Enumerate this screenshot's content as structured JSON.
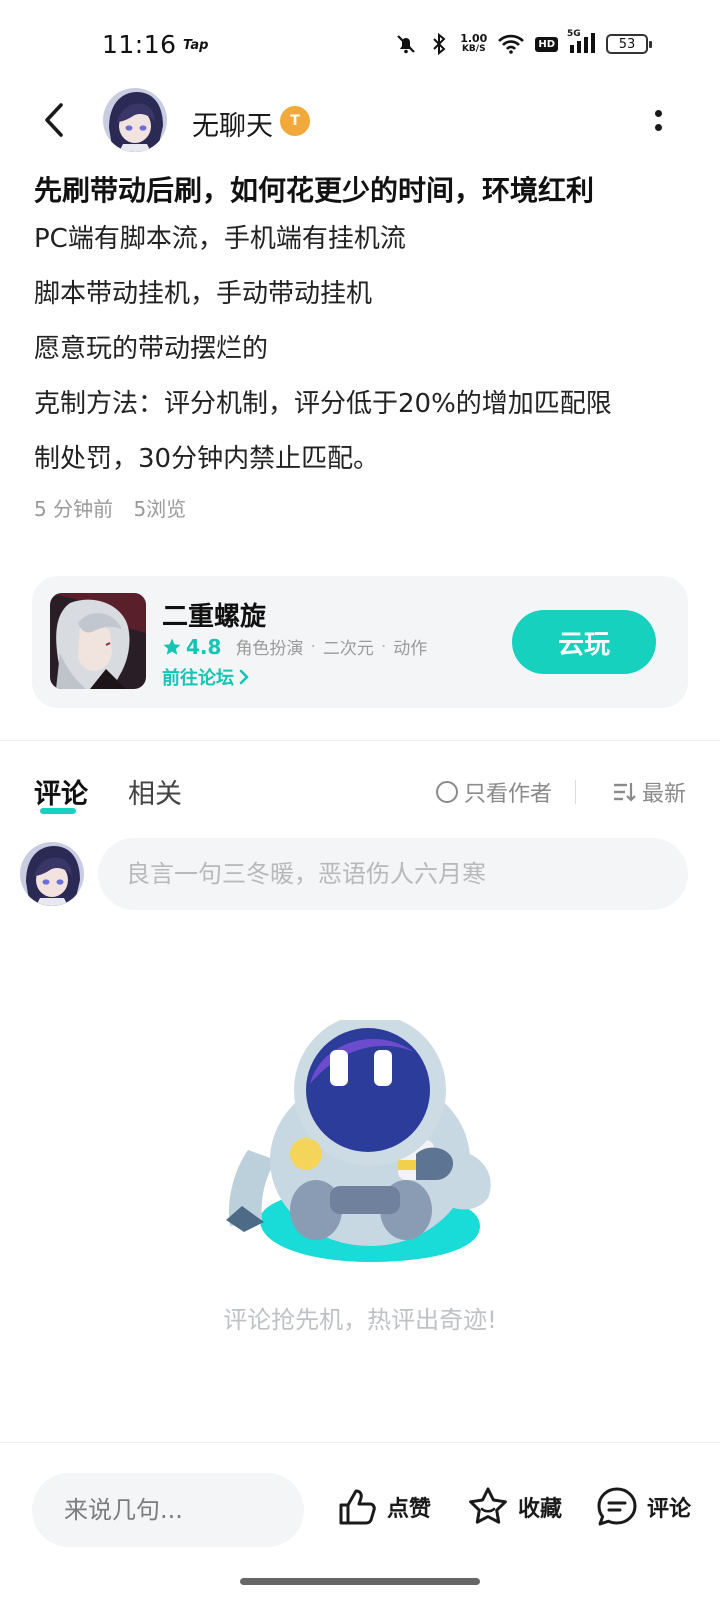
{
  "status_bar": {
    "time": "11:16",
    "app_mark": "Tap",
    "net_speed_value": "1.00",
    "net_speed_unit": "KB/S",
    "hd_label": "HD",
    "signal_label": "5G",
    "battery": "53"
  },
  "header": {
    "author_name": "无聊天",
    "badge_letter": "T"
  },
  "post": {
    "title": "先刷带动后刷，如何花更少的时间，环境红利",
    "lines": [
      "PC端有脚本流，手机端有挂机流",
      "脚本带动挂机，手动带动挂机",
      "愿意玩的带动摆烂的",
      "克制方法：评分机制，评分低于20%的增加匹配限",
      "制处罚，30分钟内禁止匹配。"
    ],
    "time_ago": "5 分钟前",
    "views": "5浏览"
  },
  "game_card": {
    "name": "二重螺旋",
    "rating": "4.8",
    "tags": [
      "角色扮演",
      "二次元",
      "动作"
    ],
    "forum_link": "前往论坛",
    "cloud_play": "云玩"
  },
  "tabs": {
    "comments": "评论",
    "related": "相关",
    "author_only": "只看作者",
    "sort": "最新"
  },
  "comment_input": {
    "placeholder": "良言一句三冬暖，恶语伤人六月寒"
  },
  "empty_state": {
    "message": "评论抢先机，热评出奇迹!"
  },
  "bottom_bar": {
    "input_placeholder": "来说几句...",
    "like": "点赞",
    "favorite": "收藏",
    "comment": "评论"
  },
  "colors": {
    "accent": "#16d1be",
    "accent_text": "#14c5b3",
    "badge": "#f2a93b"
  }
}
